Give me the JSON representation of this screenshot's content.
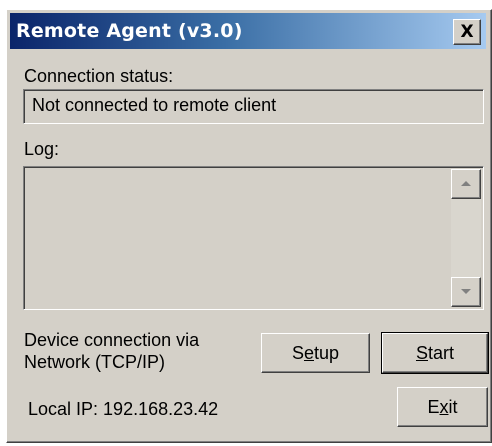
{
  "window": {
    "title": "Remote Agent (v3.0)",
    "close_label": "X",
    "close_icon": "close-icon"
  },
  "connection": {
    "label": "Connection status:",
    "value": "Not connected to remote client"
  },
  "log": {
    "label": "Log:",
    "scroll_up_icon": "scroll-up-arrow-icon",
    "scroll_down_icon": "scroll-down-arrow-icon"
  },
  "device": {
    "line1": "Device connection via",
    "line2": "Network (TCP/IP)"
  },
  "local_ip": {
    "text": "Local IP: 192.168.23.42"
  },
  "buttons": {
    "setup": {
      "pre": "S",
      "acc": "e",
      "post": "tup"
    },
    "start": {
      "pre": "",
      "acc": "S",
      "post": "tart"
    },
    "exit": {
      "pre": "E",
      "acc": "x",
      "post": "it"
    }
  },
  "colors": {
    "face": "#d4d0c8",
    "title_start": "#0a246a",
    "title_end": "#a6caf0"
  }
}
